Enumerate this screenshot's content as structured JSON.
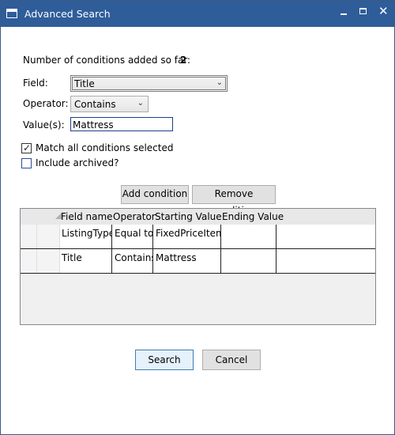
{
  "window": {
    "title": "Advanced Search",
    "titlebar_color": "#2f5d99"
  },
  "conditions": {
    "count_label": "Number of conditions added so far:",
    "count_value": "2"
  },
  "form": {
    "field_label": "Field:",
    "field_value": "Title",
    "operator_label": "Operator:",
    "operator_value": "Contains",
    "values_label": "Value(s):",
    "values_value": "Mattress",
    "match_all_label": "Match all conditions selected",
    "match_all_checked": true,
    "include_archived_label": "Include archived?",
    "include_archived_checked": false
  },
  "buttons": {
    "add_condition": "Add condition",
    "remove_condition": "Remove condition",
    "search": "Search",
    "cancel": "Cancel"
  },
  "grid": {
    "columns": [
      "Field name",
      "Operator",
      "Starting Value",
      "Ending Value"
    ],
    "rows": [
      {
        "field_name": "ListingType",
        "operator": "Equal to",
        "starting_value": "FixedPriceItem",
        "ending_value": ""
      },
      {
        "field_name": "Title",
        "operator": "Contains",
        "starting_value": "Mattress",
        "ending_value": ""
      }
    ]
  },
  "icons": {
    "app": "window-icon",
    "minimize": "minimize-icon",
    "maximize": "maximize-icon",
    "close": "close-icon",
    "dropdown": "chevron-down-icon",
    "check": "checkmark-icon"
  }
}
